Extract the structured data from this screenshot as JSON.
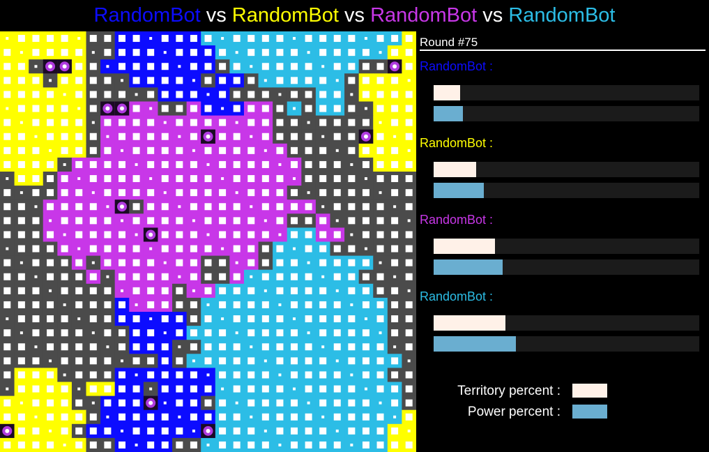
{
  "title": {
    "players": [
      {
        "name": "RandomBot",
        "color": "#0c0cff"
      },
      {
        "name": "RandomBot",
        "color": "#ffff00"
      },
      {
        "name": "RandomBot",
        "color": "#c837e8"
      },
      {
        "name": "RandomBot",
        "color": "#2cbde6"
      }
    ],
    "separator": "vs"
  },
  "round_label": "Round #75",
  "players": [
    {
      "label": "RandomBot :",
      "color": "#0c0cff",
      "territory_percent": 10,
      "power_percent": 11
    },
    {
      "label": "RandomBot :",
      "color": "#ffff00",
      "territory_percent": 16,
      "power_percent": 19
    },
    {
      "label": "RandomBot :",
      "color": "#c837e8",
      "territory_percent": 23,
      "power_percent": 26
    },
    {
      "label": "RandomBot :",
      "color": "#2cbde6",
      "territory_percent": 27,
      "power_percent": 31
    }
  ],
  "legend": {
    "territory_label": "Territory percent :",
    "power_label": "Power percent :",
    "territory_color": "#fff1e8",
    "power_color": "#6aaed0"
  },
  "board": {
    "neutral_color": "#4b4b4b",
    "rows": [
      "YYYYYYNNBBBBBBCCCCCCCCCCCCCCY",
      "YYYYYYNNBBBBBBBCCCCCCCCCCCCYY",
      "YYNNNYNBBBBBBBBNCCCCCCCCCNNYY",
      "YYYNYYNNNBBBBBNBBNCCCCCCNYYYY",
      "YYYYYYNNNNNBBBBBNNNNNNCCNYYYY",
      "YYYYYYNPPPPNNPBBBPPNCNCCNNYYY",
      "YYYYYYNPPPPPPPPPPPPNNNNNNNYYY",
      "YYYYYYNPPPPPPPPPPPPNNNNNNNYYY",
      "YYYYYYNPPPPPPPPPPPPPNNNNNYYYY",
      "YYYYNPPPPPPPPPPPPPPPPNNNNNYYY",
      "NYYNPPPPPPPPPPPPPPPPPNNNNNNNN",
      "NNNNPPPPPPPPPPPPPPPPNNNNNNNNN",
      "NNNPPPPPPNPPPPPPPPPPPPNNNNNNN",
      "NNNPPPPPPPPPPPPPPPPPNNPNNNNNN",
      "NNNPPPPPPPPPPPPPPPPPCCPPNNNNN",
      "NNNNPPPPPPPPPPPPPPNCCCCNNNNNN",
      "NNNNNPNPPPPPPPNNPPNCCCCCCCNNN",
      "NNNNNNPNPPPPPPNNPCCCCCCCCNNNN",
      "NNNNNNNNPPPPNPPCCCCCCCCCCCNNN",
      "NNNNNNNNBPPPNNCCCCCCCCCCCCCNN",
      "NNNNNNNNBBBBBNCCCCCCCCCCCCCNN",
      "NNNNNNNNNBBBBCCCCCCCCCCCCCCNN",
      "NNNNNNNNNBBBNNCCCCCCCCCCCCCNN",
      "NNNNNNNNNNNBNCCCCCCCCCCCCCCCN",
      "NYYYNNNNBBBBBBBCCCCCCCCCCCCNN",
      "NYYYYNYYBBNBBBBCCCCCCCCCCCCCN",
      "YYYYYNNBBBBBBBNCCCCCCCCCCCCCN",
      "YYYYYYNBBBBBBBBCCCCCCCCCCCCCY",
      "YYYYYNBBBBBBBBBCCCCCCCCCCCCYY",
      "YYYYYYNNBBBBNNCCCCCCCCCCCCCYY"
    ],
    "bases": [
      [
        2,
        3
      ],
      [
        2,
        4
      ],
      [
        5,
        7
      ],
      [
        5,
        8
      ],
      [
        7,
        14
      ],
      [
        2,
        27
      ],
      [
        7,
        25
      ],
      [
        7,
        14
      ],
      [
        12,
        8
      ],
      [
        14,
        10
      ],
      [
        26,
        10
      ],
      [
        28,
        0
      ],
      [
        28,
        14
      ]
    ]
  }
}
